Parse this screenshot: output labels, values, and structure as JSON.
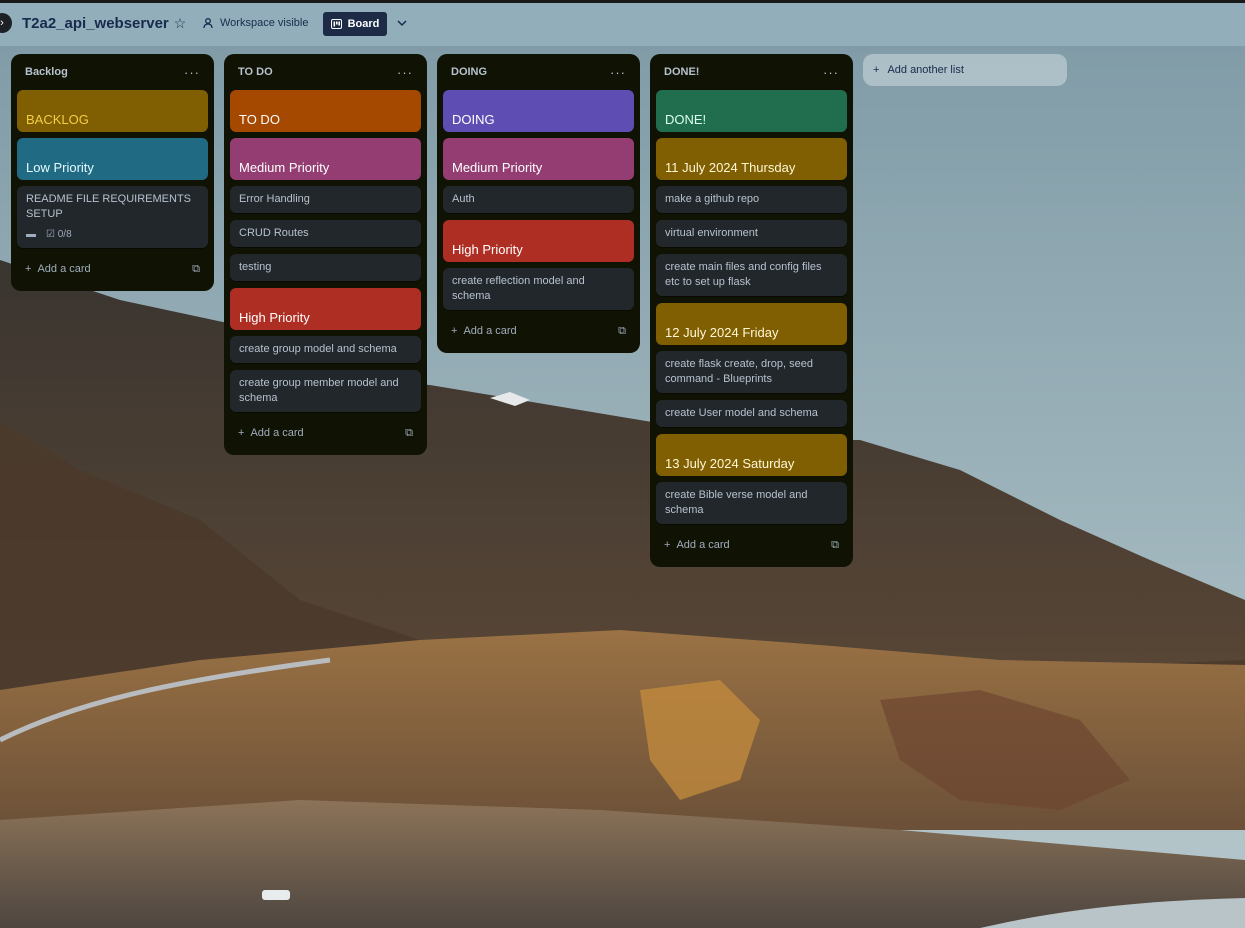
{
  "header": {
    "board_title": "T2a2_api_webserver",
    "visibility_label": "Workspace visible",
    "view_label": "Board"
  },
  "lists": [
    {
      "title": "Backlog",
      "add_card_label": "Add a card",
      "cover_cards": [
        {
          "label": "BACKLOG",
          "color": "#7f5f01"
        },
        {
          "label": "Low Priority",
          "color": "#206a83"
        }
      ],
      "cards": [
        {
          "label": "README FILE REQUIREMENTS SETUP",
          "checklist": "0/8"
        }
      ]
    },
    {
      "title": "TO DO",
      "add_card_label": "Add a card",
      "cover_cards": [
        {
          "label": "TO DO",
          "color": "#a54800"
        },
        {
          "label": "Medium Priority",
          "color": "#943d73"
        }
      ],
      "cards": [
        {
          "label": "Error Handling"
        },
        {
          "label": "CRUD Routes"
        },
        {
          "label": "testing"
        }
      ],
      "section2_cover": {
        "label": "High Priority",
        "color": "#ae2e24"
      },
      "section2_cards": [
        {
          "label": "create group model and schema"
        },
        {
          "label": "create group member model and schema"
        }
      ]
    },
    {
      "title": "DOING",
      "add_card_label": "Add a card",
      "cover_cards": [
        {
          "label": "DOING",
          "color": "#5e4db2"
        },
        {
          "label": "Medium Priority",
          "color": "#943d73"
        }
      ],
      "cards": [
        {
          "label": "Auth"
        }
      ],
      "section2_cover": {
        "label": "High Priority",
        "color": "#ae2e24"
      },
      "section2_cards": [
        {
          "label": "create reflection model and schema"
        }
      ]
    },
    {
      "title": "DONE!",
      "add_card_label": "Add a card",
      "cover_cards": [
        {
          "label": "DONE!",
          "color": "#216e4e"
        },
        {
          "label": "11 July 2024 Thursday",
          "color": "#7f5f01"
        }
      ],
      "cards": [
        {
          "label": "make a github repo"
        },
        {
          "label": "virtual environment"
        },
        {
          "label": "create main files and config files etc to set up flask"
        }
      ],
      "section2_cover": {
        "label": "12 July 2024 Friday",
        "color": "#7f5f01"
      },
      "section2_cards": [
        {
          "label": "create flask create, drop, seed command - Blueprints"
        },
        {
          "label": "create User model and schema"
        }
      ],
      "section3_cover": {
        "label": "13 July 2024 Saturday",
        "color": "#7f5f01"
      },
      "section3_cards": [
        {
          "label": "create Bible verse model and schema"
        }
      ]
    }
  ],
  "add_list_label": "Add another list"
}
